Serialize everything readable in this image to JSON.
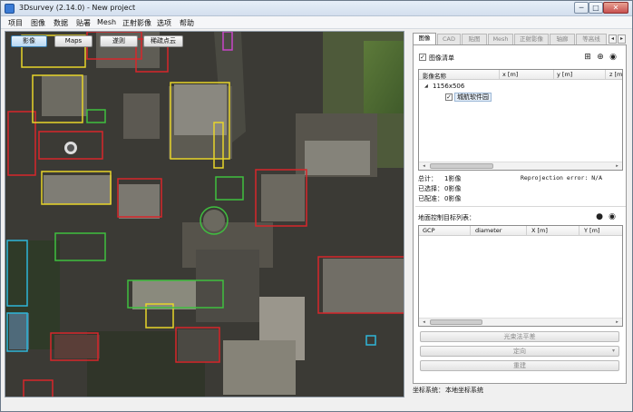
{
  "window": {
    "title": "3Dsurvey (2.14.0) - New project",
    "min_glyph": "─",
    "max_glyph": "□",
    "close_glyph": "✕"
  },
  "menu": [
    "项目",
    "图像",
    "数据",
    "贴署",
    "Mesh",
    "正射影像",
    "选项",
    "帮助"
  ],
  "viewer": {
    "buttons": [
      {
        "label": "影像",
        "active": true
      },
      {
        "label": "Maps",
        "active": false
      },
      {
        "label": "遂则",
        "active": false
      },
      {
        "label": "稀疏点云",
        "active": false
      }
    ]
  },
  "panel": {
    "tabs": [
      "图像",
      "CAD",
      "贴图",
      "Mesh",
      "正射影像",
      "轴廊",
      "等高线"
    ],
    "tab_scroll_left": "◂",
    "tab_scroll_right": "▸",
    "images_check_label": "图像清单",
    "images_check": "✓",
    "tool_icons": [
      "add-image-icon",
      "target-icon",
      "camera-icon"
    ],
    "tool_glyphs": [
      "⊞",
      "⊕",
      "◉"
    ],
    "images_columns": [
      "影像名称",
      "x [m]",
      "y [m]",
      "z [m]"
    ],
    "group_arrow": "◢",
    "group_label": "1156x506",
    "image_item": "城航软件园",
    "image_item_check": "✓",
    "scroll_left": "◂",
    "scroll_right": "▸",
    "stats": {
      "total_label": "总计：",
      "total_value": "1影像",
      "selected_label": "已选择：",
      "selected_value": "0影像",
      "aligned_label": "已配准：",
      "aligned_value": "0影像",
      "reprojection": "Reprojection error: N/A"
    },
    "gcp_title": "地面控制目标列表：",
    "gcp_icons": [
      "pin-icon",
      "eye-icon"
    ],
    "gcp_glyphs": [
      "●",
      "◉"
    ],
    "gcp_columns": [
      "GCP",
      "diameter",
      "X [m]",
      "Y [m]"
    ],
    "buttons": {
      "adjust": "光束法平差",
      "orient": "定向",
      "orient_arrow": "▾",
      "reset": "重建"
    }
  },
  "status": {
    "coord_label": "坐标系统：",
    "coord_value": "本地坐标系统"
  }
}
